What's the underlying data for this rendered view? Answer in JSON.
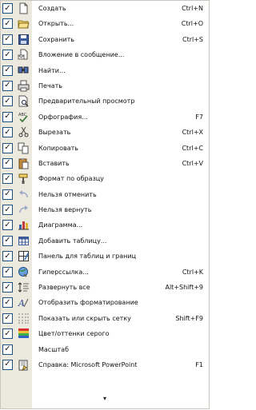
{
  "menu": {
    "items": [
      {
        "label": "Создать",
        "shortcut": "Ctrl+N",
        "icon": "new-document-icon"
      },
      {
        "label": "Открыть...",
        "shortcut": "Ctrl+O",
        "icon": "open-folder-icon"
      },
      {
        "label": "Сохранить",
        "shortcut": "Ctrl+S",
        "icon": "save-icon"
      },
      {
        "label": "Вложение в сообщение...",
        "shortcut": "",
        "icon": "attach-to-email-icon"
      },
      {
        "label": "Найти...",
        "shortcut": "",
        "icon": "find-icon"
      },
      {
        "label": "Печать",
        "shortcut": "",
        "icon": "print-icon"
      },
      {
        "label": "Предварительный просмотр",
        "shortcut": "",
        "icon": "print-preview-icon"
      },
      {
        "label": "Орфография...",
        "shortcut": "F7",
        "icon": "spelling-icon"
      },
      {
        "label": "Вырезать",
        "shortcut": "Ctrl+X",
        "icon": "cut-icon"
      },
      {
        "label": "Копировать",
        "shortcut": "Ctrl+C",
        "icon": "copy-icon"
      },
      {
        "label": "Вставить",
        "shortcut": "Ctrl+V",
        "icon": "paste-icon"
      },
      {
        "label": "Формат по образцу",
        "shortcut": "",
        "icon": "format-painter-icon"
      },
      {
        "label": "Нельзя отменить",
        "shortcut": "",
        "icon": "undo-icon"
      },
      {
        "label": "Нельзя вернуть",
        "shortcut": "",
        "icon": "redo-icon"
      },
      {
        "label": "Диаграмма...",
        "shortcut": "",
        "icon": "chart-icon"
      },
      {
        "label": "Добавить таблицу...",
        "shortcut": "",
        "icon": "insert-table-icon"
      },
      {
        "label": "Панель для таблиц и границ",
        "shortcut": "",
        "icon": "tables-borders-icon"
      },
      {
        "label": "Гиперссылка...",
        "shortcut": "Ctrl+K",
        "icon": "hyperlink-icon"
      },
      {
        "label": "Развернуть все",
        "shortcut": "Alt+Shift+9",
        "icon": "expand-all-icon"
      },
      {
        "label": "Отобразить форматирование",
        "shortcut": "",
        "icon": "show-formatting-icon"
      },
      {
        "label": "Показать или скрыть сетку",
        "shortcut": "Shift+F9",
        "icon": "grid-icon"
      },
      {
        "label": "Цвет/оттенки серого",
        "shortcut": "",
        "icon": "color-grayscale-icon"
      },
      {
        "label": "Масштаб",
        "shortcut": "",
        "icon": ""
      },
      {
        "label": "Справка: Microsoft PowerPoint",
        "shortcut": "F1",
        "icon": "help-icon"
      }
    ],
    "check_glyph": "✓",
    "more_glyph": "▾"
  },
  "colors": {
    "gutter": "#eceadf",
    "border": "#c9c6bd",
    "checkbox_border": "#1c5180"
  }
}
